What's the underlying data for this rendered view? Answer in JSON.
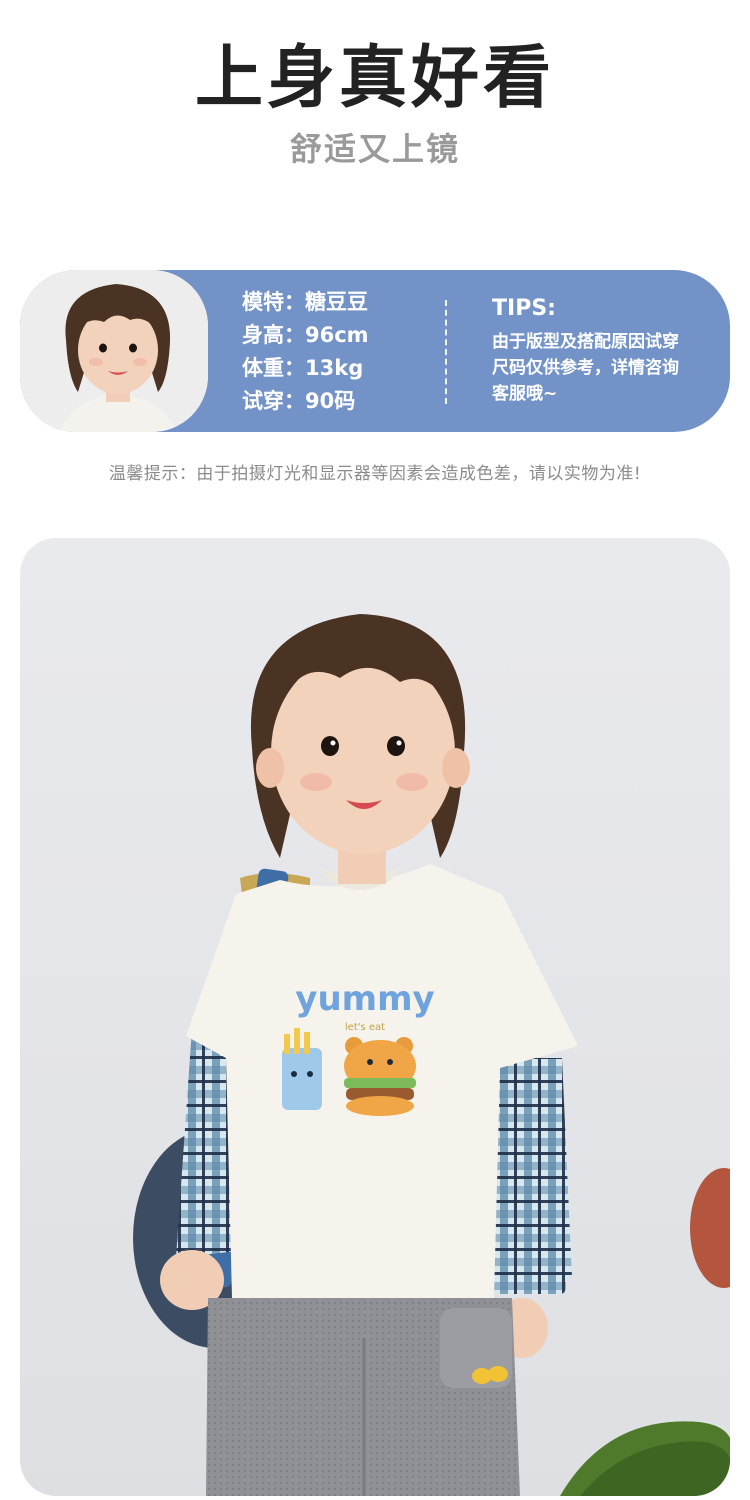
{
  "header": {
    "title": "上身真好看",
    "subtitle": "舒适又上镜"
  },
  "model_card": {
    "specs": [
      {
        "label": "模特：",
        "value": "糖豆豆"
      },
      {
        "label": "身高：",
        "value": "96cm"
      },
      {
        "label": "体重：",
        "value": "13kg"
      },
      {
        "label": "试穿：",
        "value": "90码"
      }
    ],
    "tips_title": "TIPS:",
    "tips_lines": [
      "由于版型及搭配原因试穿",
      "尺码仅供参考，详情咨询",
      "客服哦~"
    ],
    "accent_color": "#7393c8"
  },
  "notice": "温馨提示：由于拍摄灯光和显示器等因素会造成色差，请以实物为准!",
  "main_photo": {
    "print_text": "yummy",
    "print_subtext": "let's eat"
  }
}
